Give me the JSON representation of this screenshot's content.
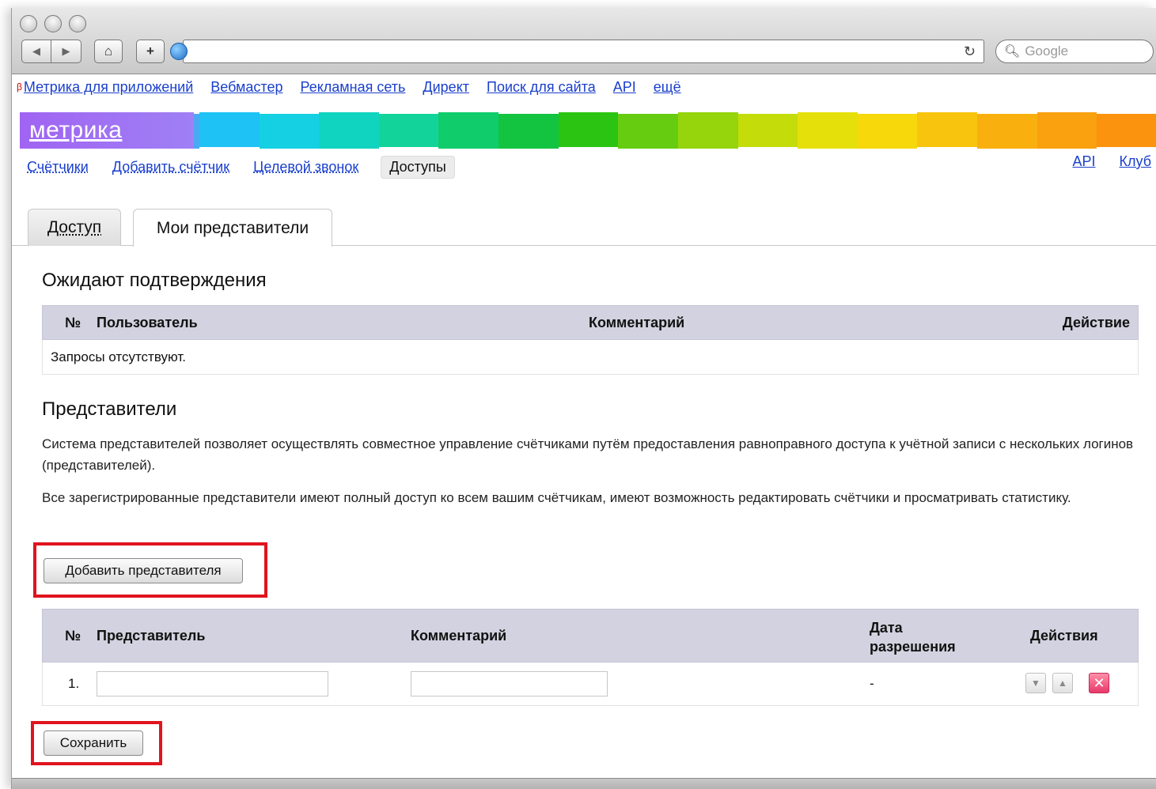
{
  "browser": {
    "search_placeholder": "Google",
    "reload_glyph": "↻",
    "home_glyph": "⌂",
    "add_glyph": "+"
  },
  "services": {
    "beta_mark": "β",
    "links": [
      "Метрика для приложений",
      "Вебмастер",
      "Рекламная сеть",
      "Директ",
      "Поиск для сайта",
      "API",
      "ещё"
    ]
  },
  "logo": {
    "text": "метрика"
  },
  "rainbow_colors": [
    "#a064f2",
    "#7d8ff5",
    "#4aa9f5",
    "#1ec2f4",
    "#15d0e2",
    "#11d4c0",
    "#12d49b",
    "#10cc6a",
    "#13c440",
    "#2cc412",
    "#66cc0f",
    "#96d40c",
    "#c3dc0a",
    "#e6e00a",
    "#f6d80b",
    "#f8c40d",
    "#f9b00e",
    "#faa10f",
    "#fb930f"
  ],
  "submenu": {
    "items": [
      "Счётчики",
      "Добавить счётчик",
      "Целевой звонок"
    ],
    "active": "Доступы",
    "right_links": [
      "API",
      "Клуб"
    ]
  },
  "tabs": {
    "inactive": "Доступ",
    "active": "Мои представители"
  },
  "pending": {
    "title": "Ожидают подтверждения",
    "headers": {
      "num": "№",
      "user": "Пользователь",
      "comment": "Комментарий",
      "action": "Действие"
    },
    "empty_text": "Запросы отсутствуют."
  },
  "reps": {
    "title": "Представители",
    "para1": "Система представителей позволяет осуществлять совместное управление счётчиками путём предоставления равноправного доступа к учётной записи с нескольких логинов (представителей).",
    "para2": "Все зарегистрированные представители имеют полный доступ ко всем вашим счётчикам, имеют возможность редактировать счётчики и просматривать статистику.",
    "add_button": "Добавить представителя",
    "headers": {
      "num": "№",
      "rep": "Представитель",
      "comment": "Комментарий",
      "date_line1": "Дата",
      "date_line2": "разрешения",
      "actions": "Действия"
    },
    "rows": [
      {
        "num": "1.",
        "rep_value": "",
        "comment_value": "",
        "date": "-"
      }
    ],
    "save_button": "Сохранить"
  },
  "colors": {
    "link": "#1a3fcc",
    "table_header": "#d2d2e0",
    "highlight": "#e0141e"
  }
}
